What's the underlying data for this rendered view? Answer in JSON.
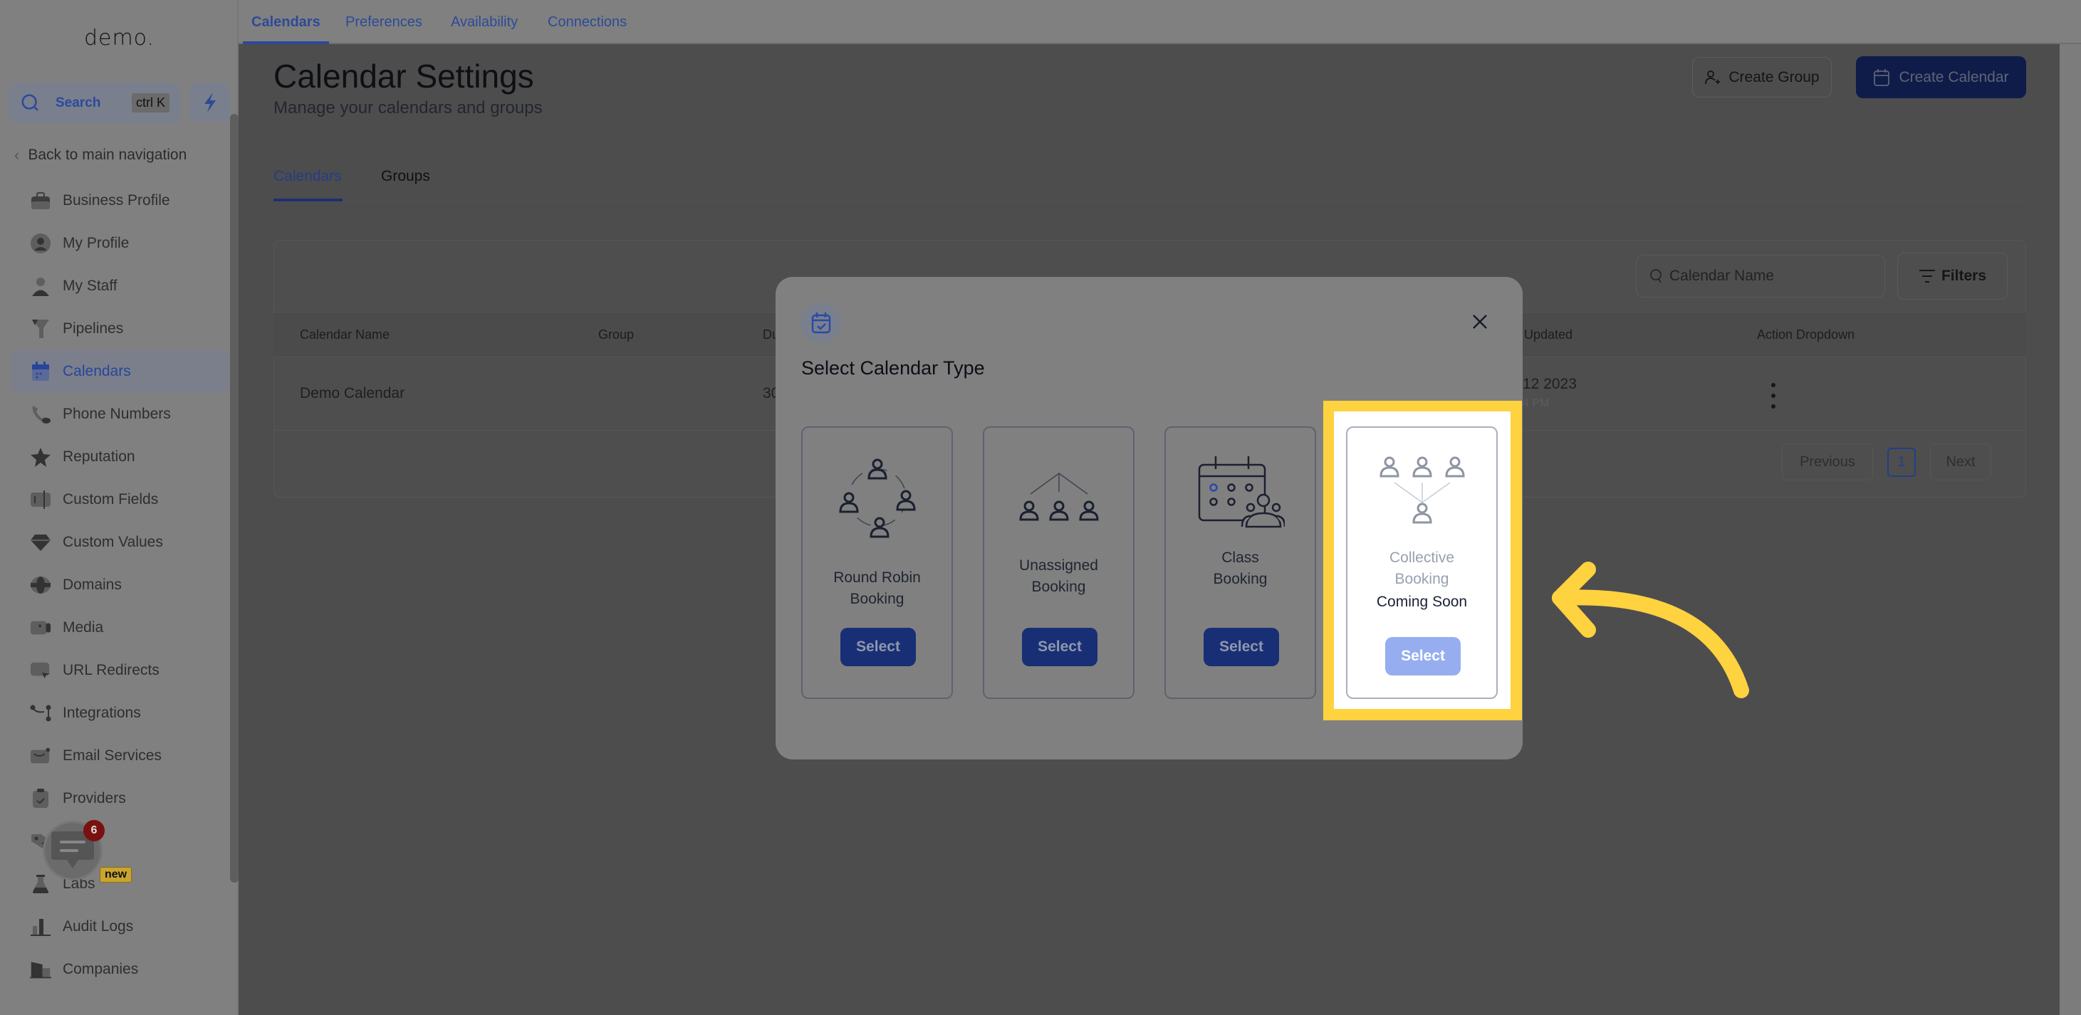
{
  "sidebar": {
    "logo": "demo.",
    "search": {
      "label": "Search",
      "shortcut": "ctrl K"
    },
    "back_link": "Back to main navigation",
    "items": [
      {
        "label": "Business Profile",
        "icon": "briefcase-icon"
      },
      {
        "label": "My Profile",
        "icon": "user-circle-icon"
      },
      {
        "label": "My Staff",
        "icon": "user-icon"
      },
      {
        "label": "Pipelines",
        "icon": "funnel-icon"
      },
      {
        "label": "Calendars",
        "icon": "calendar-icon",
        "active": true
      },
      {
        "label": "Phone Numbers",
        "icon": "phone-icon"
      },
      {
        "label": "Reputation",
        "icon": "star-icon"
      },
      {
        "label": "Custom Fields",
        "icon": "custom-fields-icon"
      },
      {
        "label": "Custom Values",
        "icon": "gem-icon"
      },
      {
        "label": "Domains",
        "icon": "globe-icon"
      },
      {
        "label": "Media",
        "icon": "video-icon"
      },
      {
        "label": "URL Redirects",
        "icon": "redirect-icon"
      },
      {
        "label": "Integrations",
        "icon": "integrations-icon"
      },
      {
        "label": "Email Services",
        "icon": "email-icon"
      },
      {
        "label": "Providers",
        "icon": "clipboard-check-icon"
      },
      {
        "label": "Tags",
        "icon": "tag-icon"
      },
      {
        "label": "Labs",
        "icon": "flask-icon",
        "badge": "new"
      },
      {
        "label": "Audit Logs",
        "icon": "chart-icon"
      },
      {
        "label": "Companies",
        "icon": "building-icon"
      }
    ],
    "chat_badge_count": "6"
  },
  "topbar": {
    "tabs": [
      {
        "label": "Calendars",
        "active": true
      },
      {
        "label": "Preferences"
      },
      {
        "label": "Availability"
      },
      {
        "label": "Connections"
      }
    ]
  },
  "page": {
    "title": "Calendar Settings",
    "subtitle": "Manage your calendars and groups",
    "create_group_label": "Create Group",
    "create_calendar_label": "Create Calendar",
    "subtabs": [
      {
        "label": "Calendars",
        "active": true
      },
      {
        "label": "Groups"
      }
    ]
  },
  "table": {
    "search_placeholder": "Calendar Name",
    "filters_label": "Filters",
    "columns": [
      "Calendar Name",
      "Group",
      "Du",
      "Updated",
      "Action Dropdown"
    ],
    "rows": [
      {
        "name": "Demo Calendar",
        "group": "",
        "duration": "30",
        "updated_date": "12 2023",
        "updated_time": "4 PM"
      }
    ],
    "pagination": {
      "previous": "Previous",
      "current": "1",
      "next": "Next"
    }
  },
  "modal": {
    "title": "Select Calendar Type",
    "cards": [
      {
        "label_line1": "Round Robin",
        "label_line2": "Booking",
        "button": "Select"
      },
      {
        "label_line1": "Unassigned",
        "label_line2": "Booking",
        "button": "Select"
      },
      {
        "label_line1": "Class",
        "label_line2": "Booking",
        "button": "Select"
      },
      {
        "label_line1": "Collective",
        "label_line2": "Booking",
        "note": "Coming Soon",
        "button": "Select",
        "disabled": true,
        "highlighted": true
      }
    ]
  },
  "colors": {
    "accent": "#2d4a97",
    "highlight": "#ffd23f",
    "disabled_button": "#96aef0"
  }
}
